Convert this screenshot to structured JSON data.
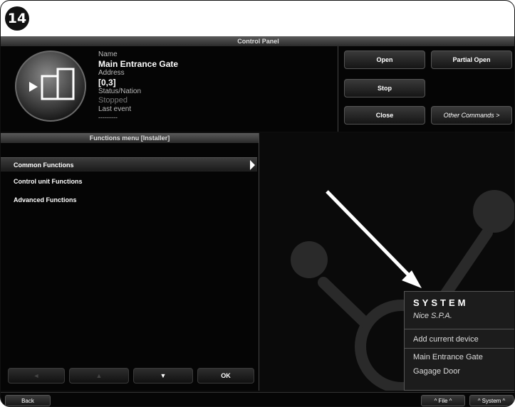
{
  "step_badge": "14",
  "app": {
    "title": "Control Panel",
    "device": {
      "name_label": "Name",
      "name_value": "Main Entrance Gate",
      "address_label": "Address",
      "address_value": "[0,3]",
      "status_label": "Status/Nation",
      "status_value": "Stopped",
      "last_event_label": "Last event",
      "last_event_value": "---------"
    },
    "commands": {
      "open": "Open",
      "partial_open": "Partial Open",
      "stop": "Stop",
      "close": "Close",
      "other": "Other Commands >"
    },
    "functions_menu": {
      "title": "Functions menu [Installer]",
      "items": [
        "Common Functions",
        "Control unit Functions",
        "Advanced Functions"
      ],
      "selected_index": 0,
      "nav": {
        "left": "◄",
        "up": "▲",
        "down": "▼",
        "ok": "OK"
      }
    },
    "system_menu": {
      "title": "SYSTEM",
      "subtitle": "Nice S.P.A.",
      "items": [
        "Add current device",
        "Main Entrance Gate",
        "Gagage Door"
      ]
    },
    "bottom": {
      "back": "Back",
      "file": "^ File ^",
      "system": "^ System ^"
    }
  },
  "colors": {
    "background": "#0c0c0c",
    "title_bar": "#3a3a3a",
    "text": "#ffffff",
    "dim_text": "#777777"
  }
}
